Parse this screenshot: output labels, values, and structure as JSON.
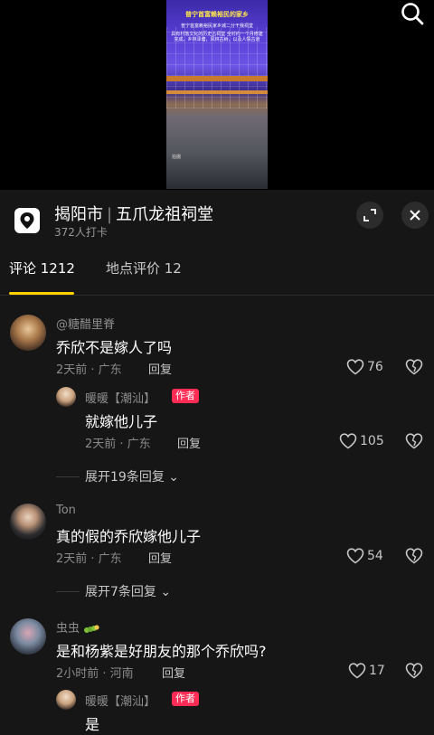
{
  "video": {
    "caption_title": "普宁首富赖裕民的家乡",
    "caption_sub": "普宁首富赖裕民家乡城二分干我祠堂",
    "caption_body": "具有村落文化的历史古祠堂 全村约一个月修建完成，乡林泽塘，风林古树，以及人情古道",
    "watermark": "拍摄"
  },
  "location": {
    "city": "揭阳市",
    "place": "五爪龙祖祠堂",
    "checkin": "372人打卡"
  },
  "tabs": [
    {
      "label": "评论 1212"
    },
    {
      "label": "地点评价 12"
    }
  ],
  "comments": [
    {
      "user": "@糖醋里脊",
      "text": "乔欣不是嫁人了吗",
      "meta": "2天前 · 广东",
      "reply": "回复",
      "likes": "76",
      "sub": {
        "user": "暖暖【潮汕】",
        "badge": "作者",
        "text": "就嫁他儿子",
        "meta": "2天前 · 广东",
        "reply": "回复",
        "likes": "105"
      },
      "expand": "展开19条回复"
    },
    {
      "user": "Ton",
      "text": "真的假的乔欣嫁他儿子",
      "meta": "2天前 · 广东",
      "reply": "回复",
      "likes": "54",
      "expand": "展开7条回复"
    },
    {
      "user": "虫虫",
      "text": "是和杨紫是好朋友的那个乔欣吗?",
      "meta": "2小时前 · 河南",
      "reply": "回复",
      "likes": "17",
      "sub": {
        "user": "暖暖【潮汕】",
        "badge": "作者",
        "text": "是"
      }
    }
  ],
  "colors": {
    "accent_underline": "#ffd000",
    "author_badge": "#fe2c55",
    "panel_bg": "#161616"
  }
}
